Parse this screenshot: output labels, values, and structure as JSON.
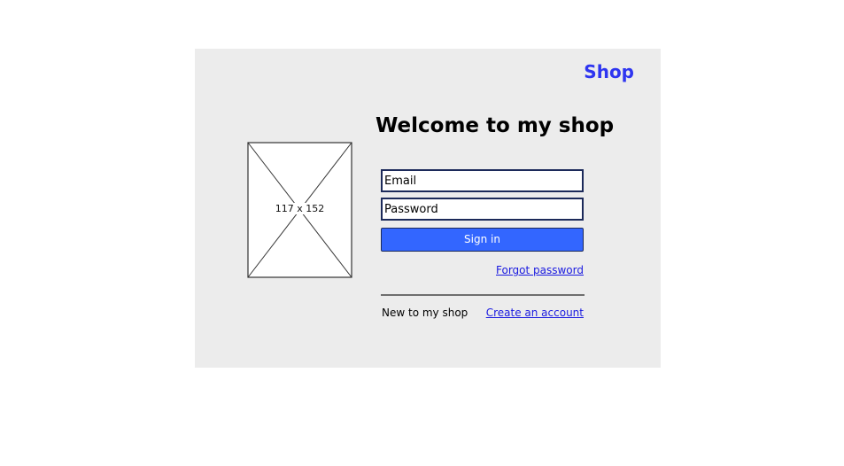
{
  "header": {
    "brand": "Shop"
  },
  "image_placeholder": {
    "dimensions_label": "117 x 152"
  },
  "login": {
    "title": "Welcome to my shop",
    "email_placeholder": "Email",
    "password_placeholder": "Password",
    "signin_label": "Sign in",
    "forgot_label": "Forgot password"
  },
  "register": {
    "prompt": "New to my shop",
    "create_label": "Create an account"
  },
  "colors": {
    "brand": "#2e35f0",
    "primary_button": "#3366ff",
    "link": "#1a1ae0",
    "panel_background": "#ececec"
  }
}
